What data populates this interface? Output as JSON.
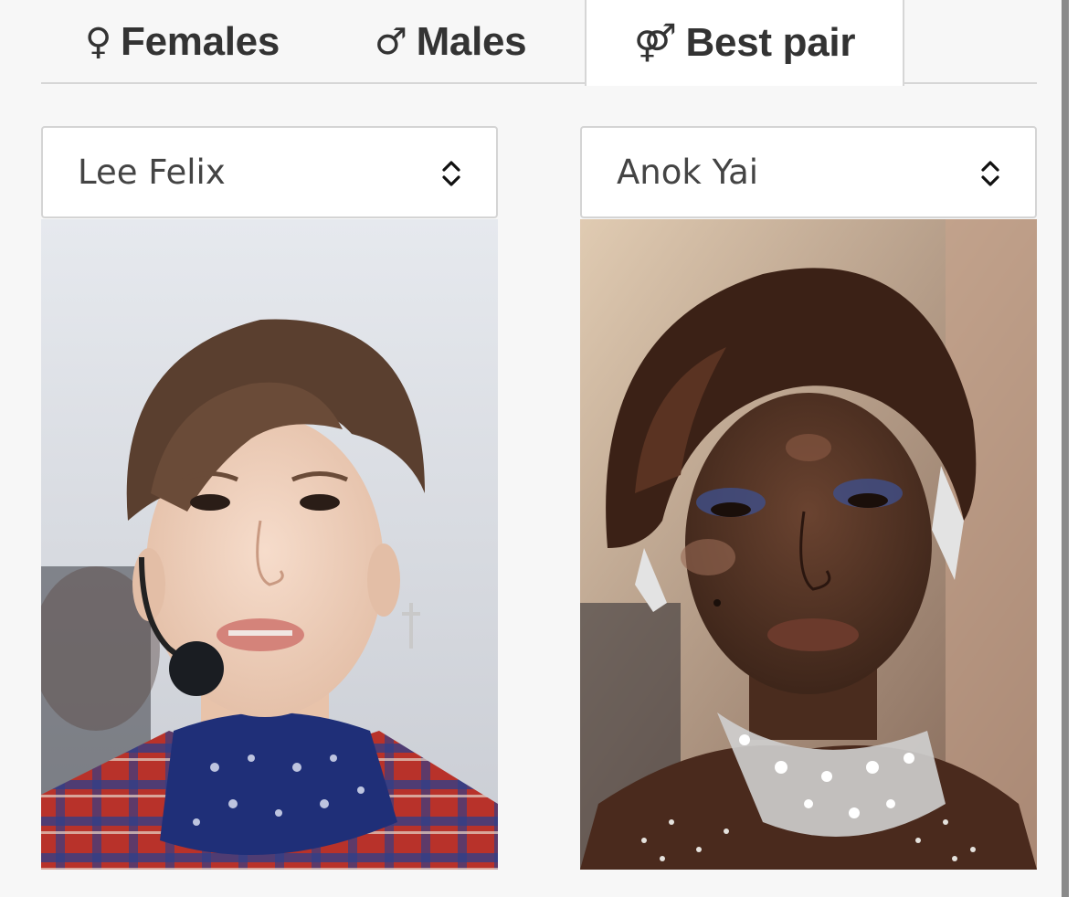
{
  "tabs": {
    "females": {
      "symbol": "♀",
      "label": "Females"
    },
    "males": {
      "symbol": "♂",
      "label": "Males"
    },
    "best_pair": {
      "symbol": "⚤",
      "label": "Best pair"
    }
  },
  "active_tab": "best_pair",
  "left_select": {
    "value": "Lee Felix",
    "icon": "chevron-up-down-icon"
  },
  "right_select": {
    "value": "Anok Yai",
    "icon": "chevron-up-down-icon"
  },
  "left_photo": {
    "subject": "Lee Felix"
  },
  "right_photo": {
    "subject": "Anok Yai"
  },
  "colors": {
    "tab_border": "#d6d6d6",
    "active_tab_bg": "#ffffff",
    "page_bg": "#f7f7f7"
  }
}
